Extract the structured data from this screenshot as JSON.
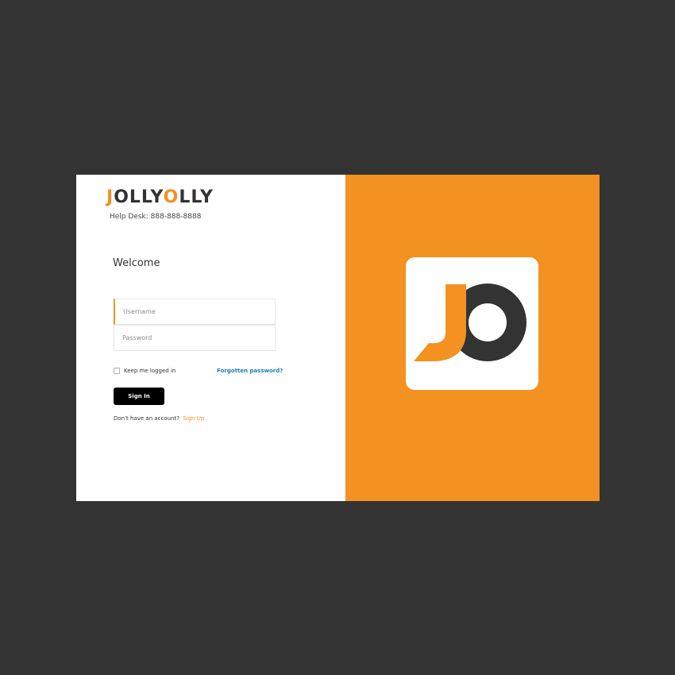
{
  "brand": {
    "logo_parts": [
      "J",
      "OLLY",
      "O",
      "LLY"
    ],
    "helpdesk": "Help Desk: 888-888-8888",
    "accent_color": "#f39121",
    "dark_color": "#333333"
  },
  "form": {
    "welcome": "Welcome",
    "username_placeholder": "Username",
    "username_value": "",
    "password_placeholder": "Password",
    "password_value": "",
    "remember_label": "Keep me logged in",
    "remember_checked": false,
    "forgot_label": "Forgotten password?",
    "signin_label": "Sign In",
    "no_account_text": "Don't have an account?",
    "signup_label": "Sign Up"
  },
  "icons": {
    "big_logo": "jo-monogram-logo",
    "checkbox": "checkbox-icon"
  }
}
